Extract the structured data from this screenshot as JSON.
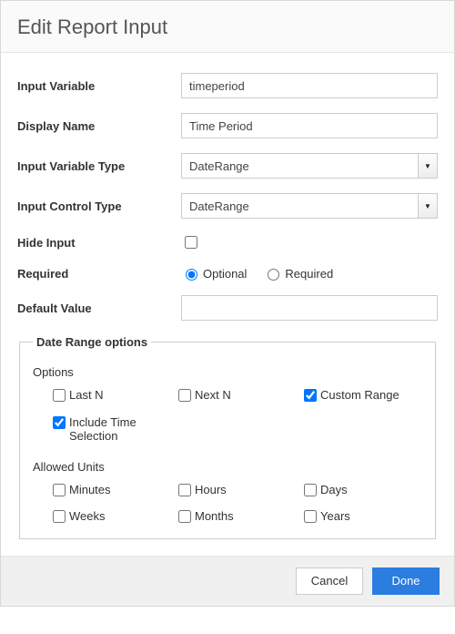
{
  "header": {
    "title": "Edit Report Input"
  },
  "labels": {
    "input_variable": "Input Variable",
    "display_name": "Display Name",
    "input_variable_type": "Input Variable Type",
    "input_control_type": "Input Control Type",
    "hide_input": "Hide Input",
    "required": "Required",
    "default_value": "Default Value",
    "date_range_options": "Date Range options",
    "options": "Options",
    "allowed_units": "Allowed Units"
  },
  "values": {
    "input_variable": "timeperiod",
    "display_name": "Time Period",
    "input_variable_type": "DateRange",
    "input_control_type": "DateRange",
    "default_value": ""
  },
  "required_choice": {
    "optional": "Optional",
    "required": "Required"
  },
  "options": {
    "last_n": "Last N",
    "next_n": "Next N",
    "custom_range": "Custom Range",
    "include_time": "Include Time Selection"
  },
  "units": {
    "minutes": "Minutes",
    "hours": "Hours",
    "days": "Days",
    "weeks": "Weeks",
    "months": "Months",
    "years": "Years"
  },
  "footer": {
    "cancel": "Cancel",
    "done": "Done"
  }
}
